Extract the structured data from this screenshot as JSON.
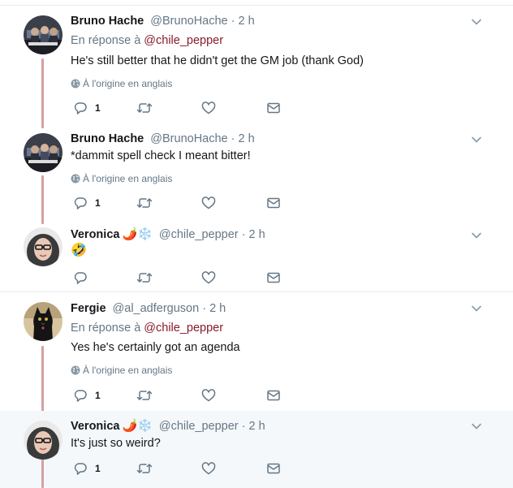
{
  "colors": {
    "thread_line": "#d3a1a3",
    "mention": "#8b1a2a",
    "muted": "#657786",
    "highlight_bg": "#f5f8fa"
  },
  "tweets": [
    {
      "name": "Bruno Hache",
      "handle": "@BrunoHache",
      "dot": "·",
      "time": "2 h",
      "reply_prefix": "En réponse à",
      "reply_mention": "@chile_pepper",
      "text": "He's still better that he didn't get the GM job (thank God)",
      "translate": "À l'origine en anglais",
      "reply_count": "1"
    },
    {
      "name": "Bruno Hache",
      "handle": "@BrunoHache",
      "dot": "·",
      "time": "2 h",
      "text": "*dammit spell check I meant bitter!",
      "translate": "À l'origine en anglais",
      "reply_count": "1"
    },
    {
      "name": "Veronica",
      "name_emoji": "🌶️❄️",
      "handle": "@chile_pepper",
      "dot": "·",
      "time": "2 h",
      "text": "🤣"
    },
    {
      "name": "Fergie",
      "handle": "@al_adferguson",
      "dot": "·",
      "time": "2 h",
      "reply_prefix": "En réponse à",
      "reply_mention": "@chile_pepper",
      "text": "Yes he's certainly got an agenda",
      "translate": "À l'origine en anglais",
      "reply_count": "1"
    },
    {
      "name": "Veronica",
      "name_emoji": "🌶️❄️",
      "handle": "@chile_pepper",
      "dot": "·",
      "time": "2 h",
      "text": "It's just so weird?",
      "reply_count": "1"
    }
  ]
}
